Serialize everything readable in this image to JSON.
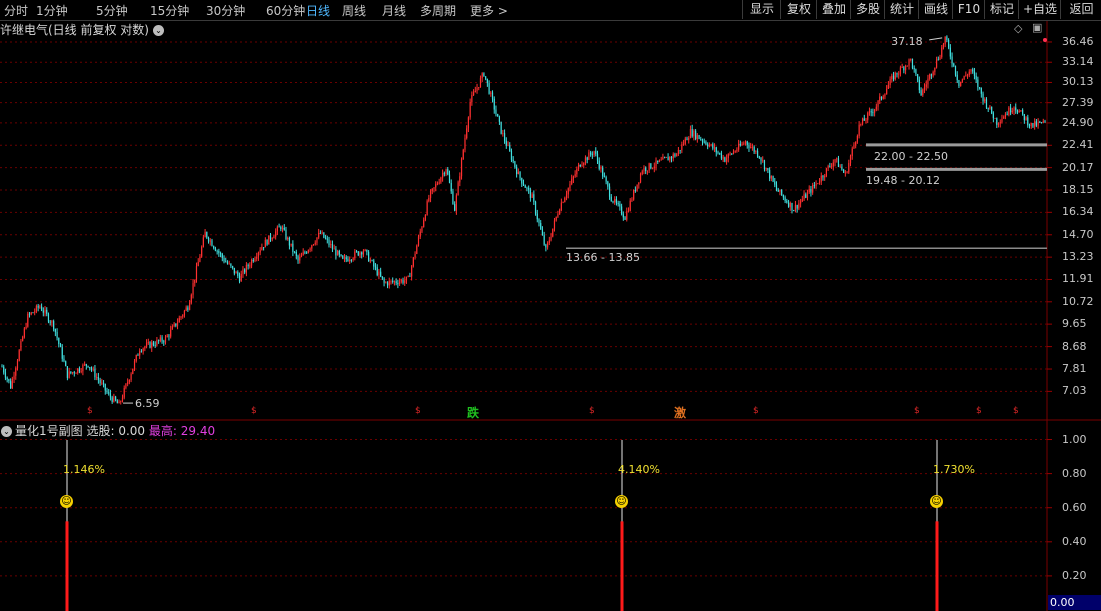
{
  "toolbar": {
    "periods": [
      "分时",
      "1分钟",
      "5分钟",
      "15分钟",
      "30分钟",
      "60分钟",
      "日线",
      "周线",
      "月线",
      "多周期",
      "更多 >"
    ],
    "active_period": "日线",
    "right_buttons": [
      "显示",
      "复权",
      "叠加",
      "多股",
      "统计",
      "画线",
      "F10",
      "标记",
      "+自选",
      "返回"
    ]
  },
  "stock": {
    "title": "许继电气(日线 前复权 对数)"
  },
  "price_axis": {
    "ticks": [
      "36.46",
      "33.14",
      "30.13",
      "27.39",
      "24.90",
      "22.41",
      "20.17",
      "18.15",
      "16.34",
      "14.70",
      "13.23",
      "11.91",
      "10.72",
      "9.65",
      "8.68",
      "7.81",
      "7.03"
    ],
    "scale": "log",
    "min": 6.5,
    "max": 37.5
  },
  "annotations": {
    "high": "37.18",
    "low": "6.59",
    "selection_ranges": [
      "22.00 - 22.50",
      "19.48 - 20.12",
      "13.66 - 13.85"
    ]
  },
  "signals": {
    "marker": "$",
    "tags": [
      {
        "text": "跌",
        "color": "#20c020"
      },
      {
        "text": "激",
        "color": "#e07020"
      }
    ]
  },
  "indicator": {
    "name": "量化1号副图",
    "select_label": "选股:",
    "select_value": "0.00",
    "high_label": "最高:",
    "high_value": "29.40",
    "axis_ticks": [
      "1.00",
      "0.80",
      "0.60",
      "0.40",
      "0.20"
    ],
    "current_value": "0.00",
    "signals": [
      {
        "pct": "1.146%",
        "value": 0.52
      },
      {
        "pct": "4.140%",
        "value": 0.52
      },
      {
        "pct": "1.730%",
        "value": 0.52
      }
    ]
  },
  "colors": {
    "up": "#ff3030",
    "down": "#40e0e0",
    "grid": "#6a0000",
    "smiley": "#f6d000",
    "volume_bar": "#ff1a1a"
  },
  "chart_data": {
    "type": "candlestick",
    "title": "许继电气(日线 前复权 对数)",
    "scale": "log",
    "ylim": [
      6.5,
      37.5
    ],
    "y_ticks": [
      36.46,
      33.14,
      30.13,
      27.39,
      24.9,
      22.41,
      20.17,
      18.15,
      16.34,
      14.7,
      13.23,
      11.91,
      10.72,
      9.65,
      8.68,
      7.81,
      7.03
    ],
    "path_anchors": [
      {
        "bar": 0,
        "price": 7.9
      },
      {
        "bar": 5,
        "price": 7.2
      },
      {
        "bar": 15,
        "price": 10.0
      },
      {
        "bar": 22,
        "price": 10.5
      },
      {
        "bar": 30,
        "price": 9.6
      },
      {
        "bar": 38,
        "price": 7.6
      },
      {
        "bar": 50,
        "price": 8.0
      },
      {
        "bar": 62,
        "price": 6.9
      },
      {
        "bar": 68,
        "price": 6.59
      },
      {
        "bar": 80,
        "price": 8.6
      },
      {
        "bar": 95,
        "price": 9.0
      },
      {
        "bar": 108,
        "price": 10.5
      },
      {
        "bar": 118,
        "price": 14.8
      },
      {
        "bar": 128,
        "price": 13.2
      },
      {
        "bar": 138,
        "price": 12.0
      },
      {
        "bar": 150,
        "price": 13.8
      },
      {
        "bar": 162,
        "price": 15.3
      },
      {
        "bar": 172,
        "price": 13.0
      },
      {
        "bar": 185,
        "price": 14.8
      },
      {
        "bar": 198,
        "price": 13.0
      },
      {
        "bar": 210,
        "price": 13.7
      },
      {
        "bar": 222,
        "price": 11.7
      },
      {
        "bar": 236,
        "price": 11.9
      },
      {
        "bar": 248,
        "price": 17.5
      },
      {
        "bar": 258,
        "price": 20.2
      },
      {
        "bar": 263,
        "price": 16.6
      },
      {
        "bar": 272,
        "price": 27.5
      },
      {
        "bar": 280,
        "price": 31.5
      },
      {
        "bar": 290,
        "price": 24.0
      },
      {
        "bar": 300,
        "price": 19.5
      },
      {
        "bar": 308,
        "price": 17.5
      },
      {
        "bar": 316,
        "price": 13.66
      },
      {
        "bar": 324,
        "price": 16.8
      },
      {
        "bar": 336,
        "price": 20.6
      },
      {
        "bar": 344,
        "price": 21.8
      },
      {
        "bar": 354,
        "price": 17.5
      },
      {
        "bar": 362,
        "price": 16.0
      },
      {
        "bar": 372,
        "price": 20.0
      },
      {
        "bar": 380,
        "price": 20.5
      },
      {
        "bar": 392,
        "price": 21.5
      },
      {
        "bar": 400,
        "price": 23.9
      },
      {
        "bar": 410,
        "price": 22.6
      },
      {
        "bar": 420,
        "price": 21.0
      },
      {
        "bar": 432,
        "price": 22.8
      },
      {
        "bar": 440,
        "price": 21.4
      },
      {
        "bar": 450,
        "price": 18.2
      },
      {
        "bar": 460,
        "price": 16.6
      },
      {
        "bar": 472,
        "price": 18.5
      },
      {
        "bar": 484,
        "price": 21.0
      },
      {
        "bar": 490,
        "price": 19.48
      },
      {
        "bar": 498,
        "price": 24.5
      },
      {
        "bar": 508,
        "price": 27.0
      },
      {
        "bar": 518,
        "price": 31.0
      },
      {
        "bar": 528,
        "price": 33.5
      },
      {
        "bar": 534,
        "price": 28.5
      },
      {
        "bar": 545,
        "price": 34.5
      },
      {
        "bar": 548,
        "price": 37.18
      },
      {
        "bar": 556,
        "price": 30.0
      },
      {
        "bar": 563,
        "price": 32.0
      },
      {
        "bar": 570,
        "price": 28.0
      },
      {
        "bar": 578,
        "price": 25.0
      },
      {
        "bar": 588,
        "price": 27.0
      },
      {
        "bar": 598,
        "price": 24.6
      },
      {
        "bar": 606,
        "price": 24.9
      }
    ],
    "levels": [
      22.0,
      20.12,
      13.75
    ]
  }
}
